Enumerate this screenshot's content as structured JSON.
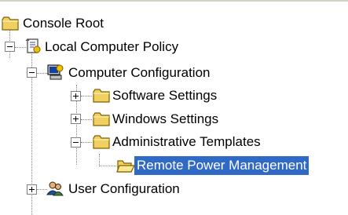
{
  "tree": {
    "nodes": [
      {
        "label": "Console Root",
        "icon": "folder-icon",
        "selected": false
      },
      {
        "label": "Local Computer Policy",
        "icon": "policy-scroll-icon",
        "selected": false
      },
      {
        "label": "Computer Configuration",
        "icon": "computer-icon",
        "selected": false
      },
      {
        "label": "Software Settings",
        "icon": "folder-icon",
        "selected": false
      },
      {
        "label": "Windows Settings",
        "icon": "folder-icon",
        "selected": false
      },
      {
        "label": "Administrative Templates",
        "icon": "folder-icon",
        "selected": false
      },
      {
        "label": "Remote Power Management",
        "icon": "open-folder-icon",
        "selected": true
      },
      {
        "label": "User Configuration",
        "icon": "users-icon",
        "selected": false
      }
    ],
    "colors": {
      "selection": "#316ac5",
      "folder": "#f0d060",
      "folder_outline": "#806000"
    }
  }
}
